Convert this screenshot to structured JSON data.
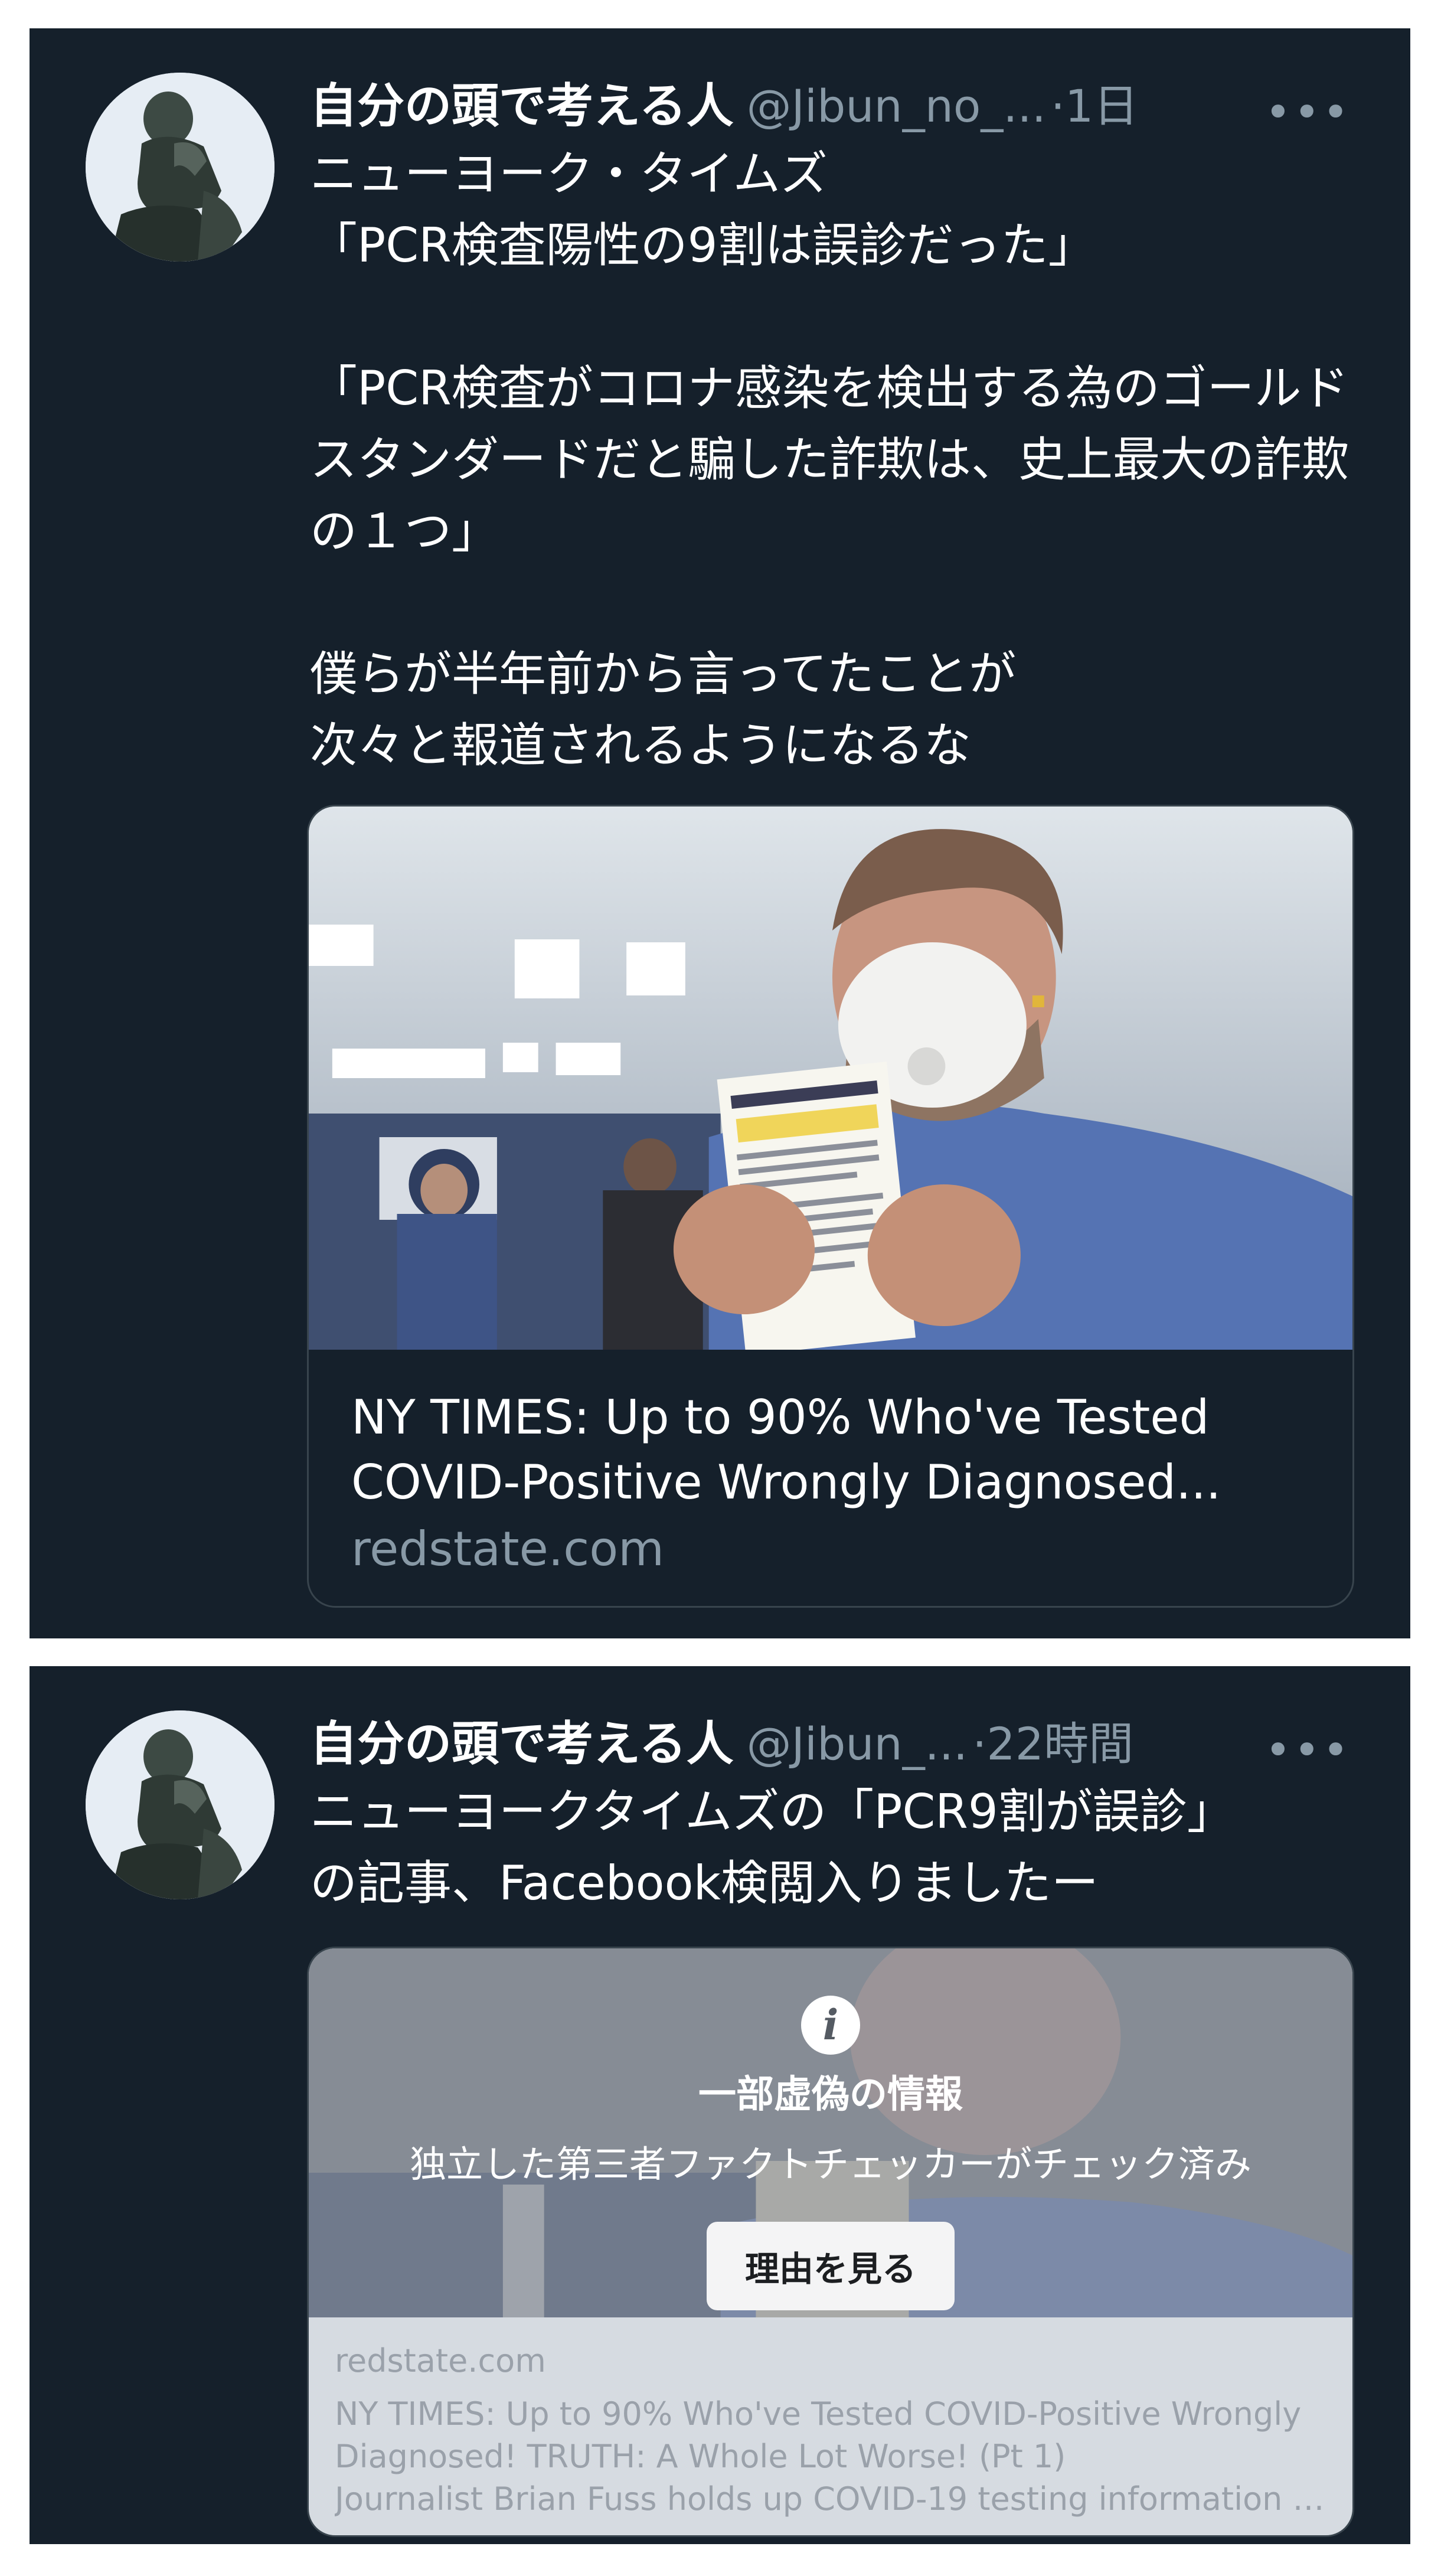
{
  "tweets": [
    {
      "author_name": "自分の頭で考える人",
      "handle": "@Jibun_no_...",
      "time": "·1日",
      "more": "•••",
      "text": "ニューヨーク・タイムズ\n「PCR検査陽性の9割は誤診だった」\n\n「PCR検査がコロナ感染を検出する為のゴールドスタンダードだと騙した詐欺は、史上最大の詐欺の１つ」\n\n僕らが半年前から言ってたことが\n次々と報道されるようになるな",
      "link_card": {
        "title": "NY TIMES: Up to 90% Who've Tested COVID-Positive Wrongly Diagnosed...",
        "domain": "redstate.com"
      }
    },
    {
      "author_name": "自分の頭で考える人",
      "handle": "@Jibun_...",
      "time": "·22時間",
      "more": "•••",
      "text": "ニューヨークタイムズの「PCR9割が誤診」\nの記事、Facebook検閲入りましたー",
      "fact_check": {
        "icon": "info-icon",
        "title": "一部虚偽の情報",
        "description": "独立した第三者ファクトチェッカーがチェック済み",
        "button_label": "理由を見る",
        "domain": "redstate.com",
        "line1": "NY TIMES: Up to 90% Who've Tested COVID-Positive Wrongly",
        "line2": "Diagnosed! TRUTH: A Whole Lot Worse! (Pt 1)",
        "line3": "Journalist Brian Fuss holds up COVID-19 testing information af..."
      }
    }
  ],
  "colors": {
    "card_background": "#15202b",
    "secondary_text": "#8899a6",
    "border": "#38444d"
  }
}
